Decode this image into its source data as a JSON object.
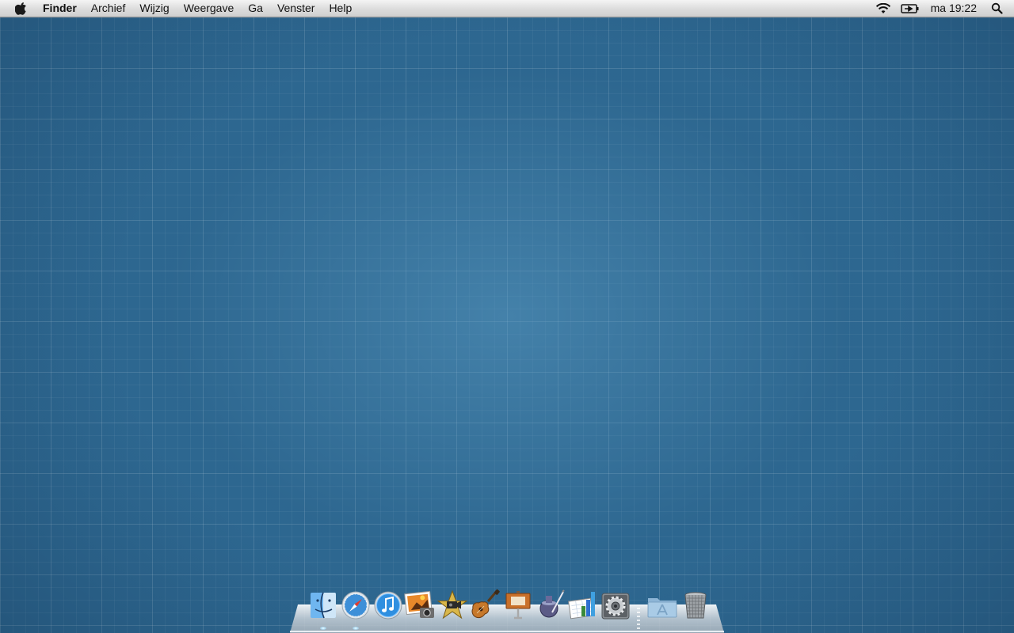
{
  "menubar": {
    "apple_menu": "apple-logo-icon",
    "app_name": "Finder",
    "menus": [
      "Archief",
      "Wijzig",
      "Weergave",
      "Ga",
      "Venster",
      "Help"
    ],
    "status": {
      "wifi": "wifi-icon",
      "battery": "battery-charging-icon",
      "clock": "ma 19:22",
      "spotlight": "spotlight-search-icon"
    }
  },
  "desktop": {
    "wallpaper": "blueprint-grid",
    "colors": {
      "base": "#2e6891",
      "center": "#4b8db8",
      "grid": "#ffffff"
    }
  },
  "dock": {
    "items": [
      {
        "icon": "finder-icon",
        "running": true
      },
      {
        "icon": "safari-icon",
        "running": true
      },
      {
        "icon": "itunes-icon",
        "running": false
      },
      {
        "icon": "iphoto-icon",
        "running": false
      },
      {
        "icon": "imovie-icon",
        "running": false
      },
      {
        "icon": "garageband-icon",
        "running": false
      },
      {
        "icon": "keynote-icon",
        "running": false
      },
      {
        "icon": "iweb-icon",
        "running": false
      },
      {
        "icon": "numbers-icon",
        "running": false
      },
      {
        "icon": "system-preferences-icon",
        "running": false
      }
    ],
    "stacks": [
      {
        "icon": "applications-folder-icon"
      },
      {
        "icon": "trash-icon"
      }
    ]
  }
}
